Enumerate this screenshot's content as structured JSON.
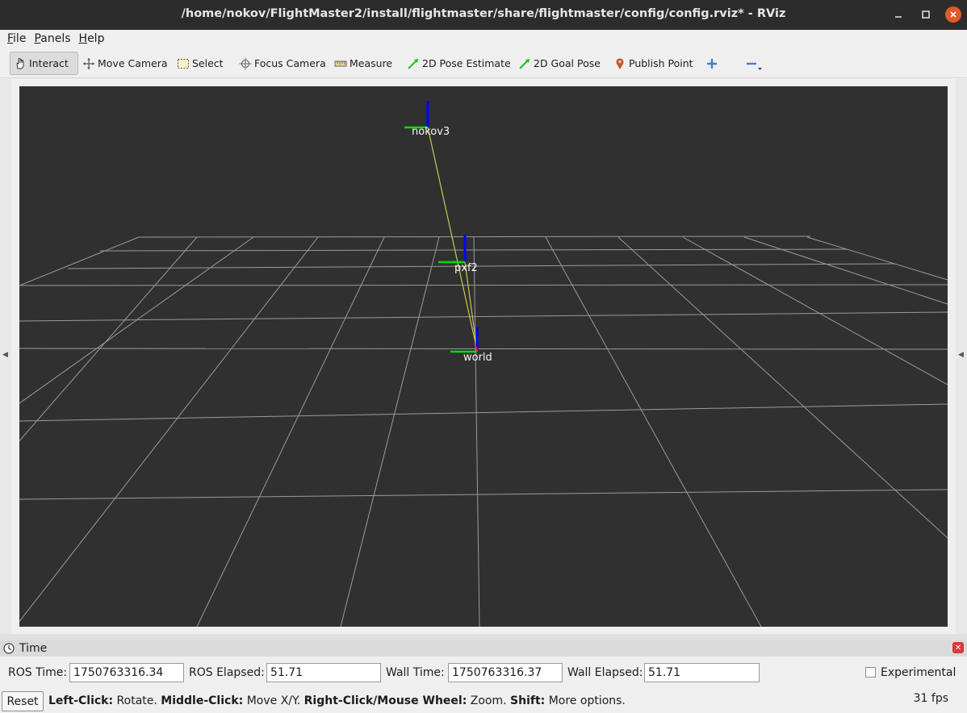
{
  "window": {
    "title": "/home/nokov/FlightMaster2/install/flightmaster/share/flightmaster/config/config.rviz* - RViz"
  },
  "menu": [
    {
      "mnemonic": "F",
      "rest": "ile"
    },
    {
      "mnemonic": "P",
      "rest": "anels"
    },
    {
      "mnemonic": "H",
      "rest": "elp"
    }
  ],
  "toolbar": {
    "interact": "Interact",
    "move_camera": "Move Camera",
    "select": "Select",
    "focus_camera": "Focus Camera",
    "measure": "Measure",
    "pose_estimate": "2D Pose Estimate",
    "goal_pose": "2D Goal Pose",
    "publish_point": "Publish Point"
  },
  "viewport": {
    "frames": [
      {
        "name": "nokov3"
      },
      {
        "name": "pxf2"
      },
      {
        "name": "world"
      }
    ],
    "colors": {
      "background": "#303030",
      "grid": "#9a9a9a",
      "x_axis": "#ff2020",
      "y_axis": "#00e000",
      "z_axis": "#0000ff",
      "tf_link": "#c8c850"
    }
  },
  "time_panel": {
    "title": "Time",
    "ros_time_label": "ROS Time:",
    "ros_time": "1750763316.34",
    "ros_elapsed_label": "ROS Elapsed:",
    "ros_elapsed": "51.71",
    "wall_time_label": "Wall Time:",
    "wall_time": "1750763316.37",
    "wall_elapsed_label": "Wall Elapsed:",
    "wall_elapsed": "51.71",
    "experimental_label": "Experimental"
  },
  "status": {
    "reset": "Reset",
    "left_click": "Left-Click:",
    "left_action": " Rotate. ",
    "middle_click": "Middle-Click:",
    "middle_action": " Move X/Y. ",
    "right_click": "Right-Click/Mouse Wheel:",
    "right_action": " Zoom. ",
    "shift": "Shift:",
    "shift_action": " More options.",
    "fps": "31 fps"
  }
}
